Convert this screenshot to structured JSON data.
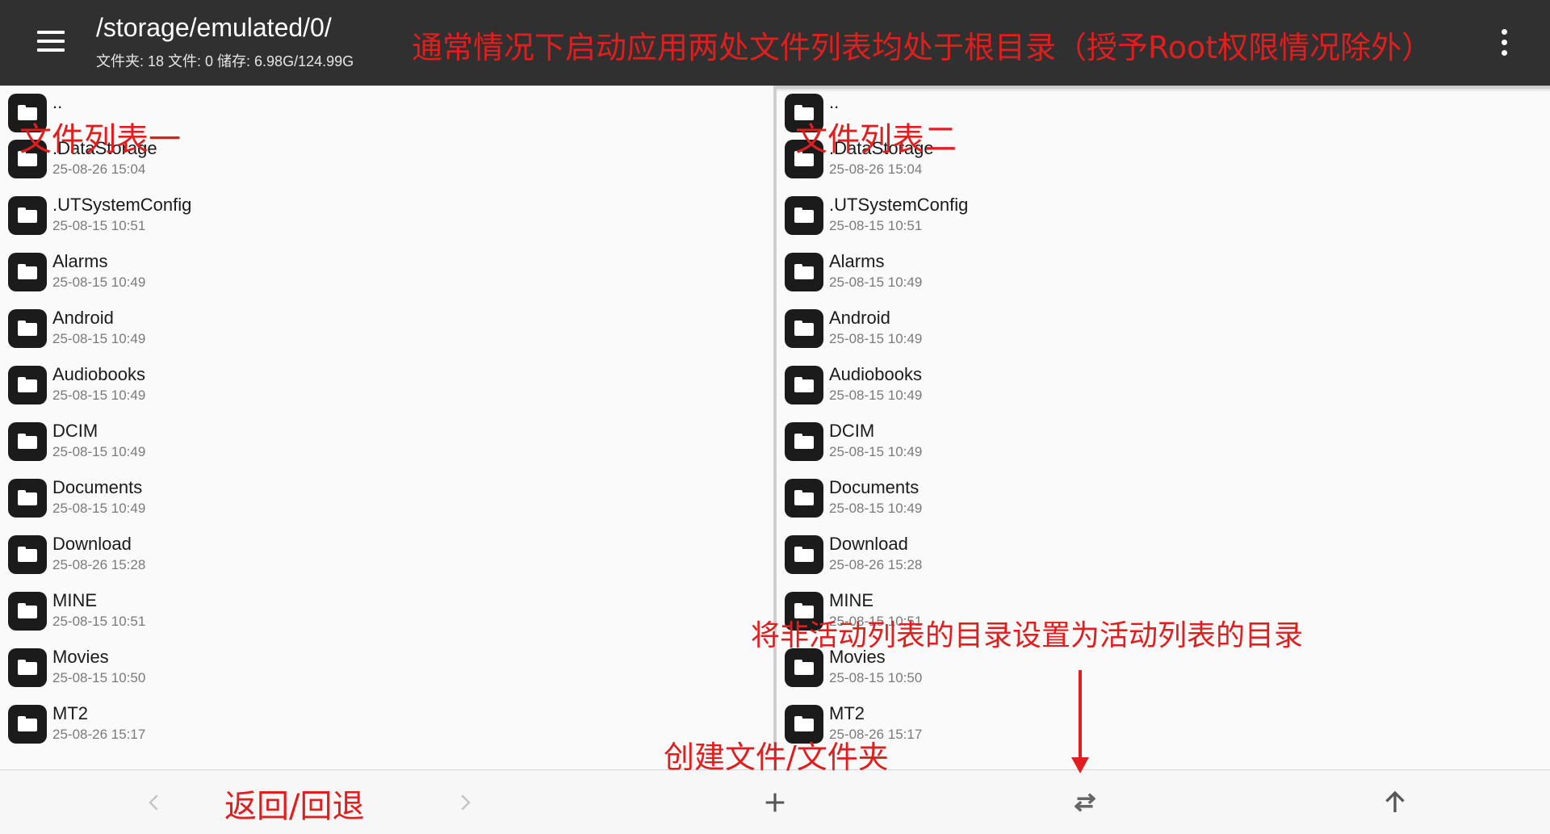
{
  "header": {
    "path": "/storage/emulated/0/",
    "stats": "文件夹: 18  文件: 0  储存: 6.98G/124.99G"
  },
  "left_panel": {
    "items": [
      {
        "name": "..",
        "date": ""
      },
      {
        "name": ".DataStorage",
        "date": "25-08-26 15:04"
      },
      {
        "name": ".UTSystemConfig",
        "date": "25-08-15 10:51"
      },
      {
        "name": "Alarms",
        "date": "25-08-15 10:49"
      },
      {
        "name": "Android",
        "date": "25-08-15 10:49"
      },
      {
        "name": "Audiobooks",
        "date": "25-08-15 10:49"
      },
      {
        "name": "DCIM",
        "date": "25-08-15 10:49"
      },
      {
        "name": "Documents",
        "date": "25-08-15 10:49"
      },
      {
        "name": "Download",
        "date": "25-08-26 15:28"
      },
      {
        "name": "MINE",
        "date": "25-08-15 10:51"
      },
      {
        "name": "Movies",
        "date": "25-08-15 10:50"
      },
      {
        "name": "MT2",
        "date": "25-08-26 15:17"
      }
    ]
  },
  "right_panel": {
    "items": [
      {
        "name": "..",
        "date": ""
      },
      {
        "name": ".DataStorage",
        "date": "25-08-26 15:04"
      },
      {
        "name": ".UTSystemConfig",
        "date": "25-08-15 10:51"
      },
      {
        "name": "Alarms",
        "date": "25-08-15 10:49"
      },
      {
        "name": "Android",
        "date": "25-08-15 10:49"
      },
      {
        "name": "Audiobooks",
        "date": "25-08-15 10:49"
      },
      {
        "name": "DCIM",
        "date": "25-08-15 10:49"
      },
      {
        "name": "Documents",
        "date": "25-08-15 10:49"
      },
      {
        "name": "Download",
        "date": "25-08-26 15:28"
      },
      {
        "name": "MINE",
        "date": "25-08-15 10:51"
      },
      {
        "name": "Movies",
        "date": "25-08-15 10:50"
      },
      {
        "name": "MT2",
        "date": "25-08-26 15:17"
      }
    ]
  },
  "annotations": {
    "top_note": "通常情况下启动应用两处文件列表均处于根目录（授予Root权限情况除外）",
    "list_one": "文件列表一",
    "list_two": "文件列表二",
    "sync_note": "将非活动列表的目录设置为活动列表的目录",
    "create_note": "创建文件/文件夹",
    "back_note": "返回/回退"
  },
  "icons": {
    "menu": "hamburger-menu-icon",
    "overflow": "more-vert-icon",
    "folder": "folder-icon",
    "back": "chevron-left-icon",
    "forward": "chevron-right-icon",
    "create": "plus-icon",
    "swap": "swap-horiz-icon",
    "up": "arrow-up-icon"
  },
  "colors": {
    "topbar": "#303030",
    "annotation": "#e01e1e",
    "folder_icon": "#1b1b1b"
  }
}
